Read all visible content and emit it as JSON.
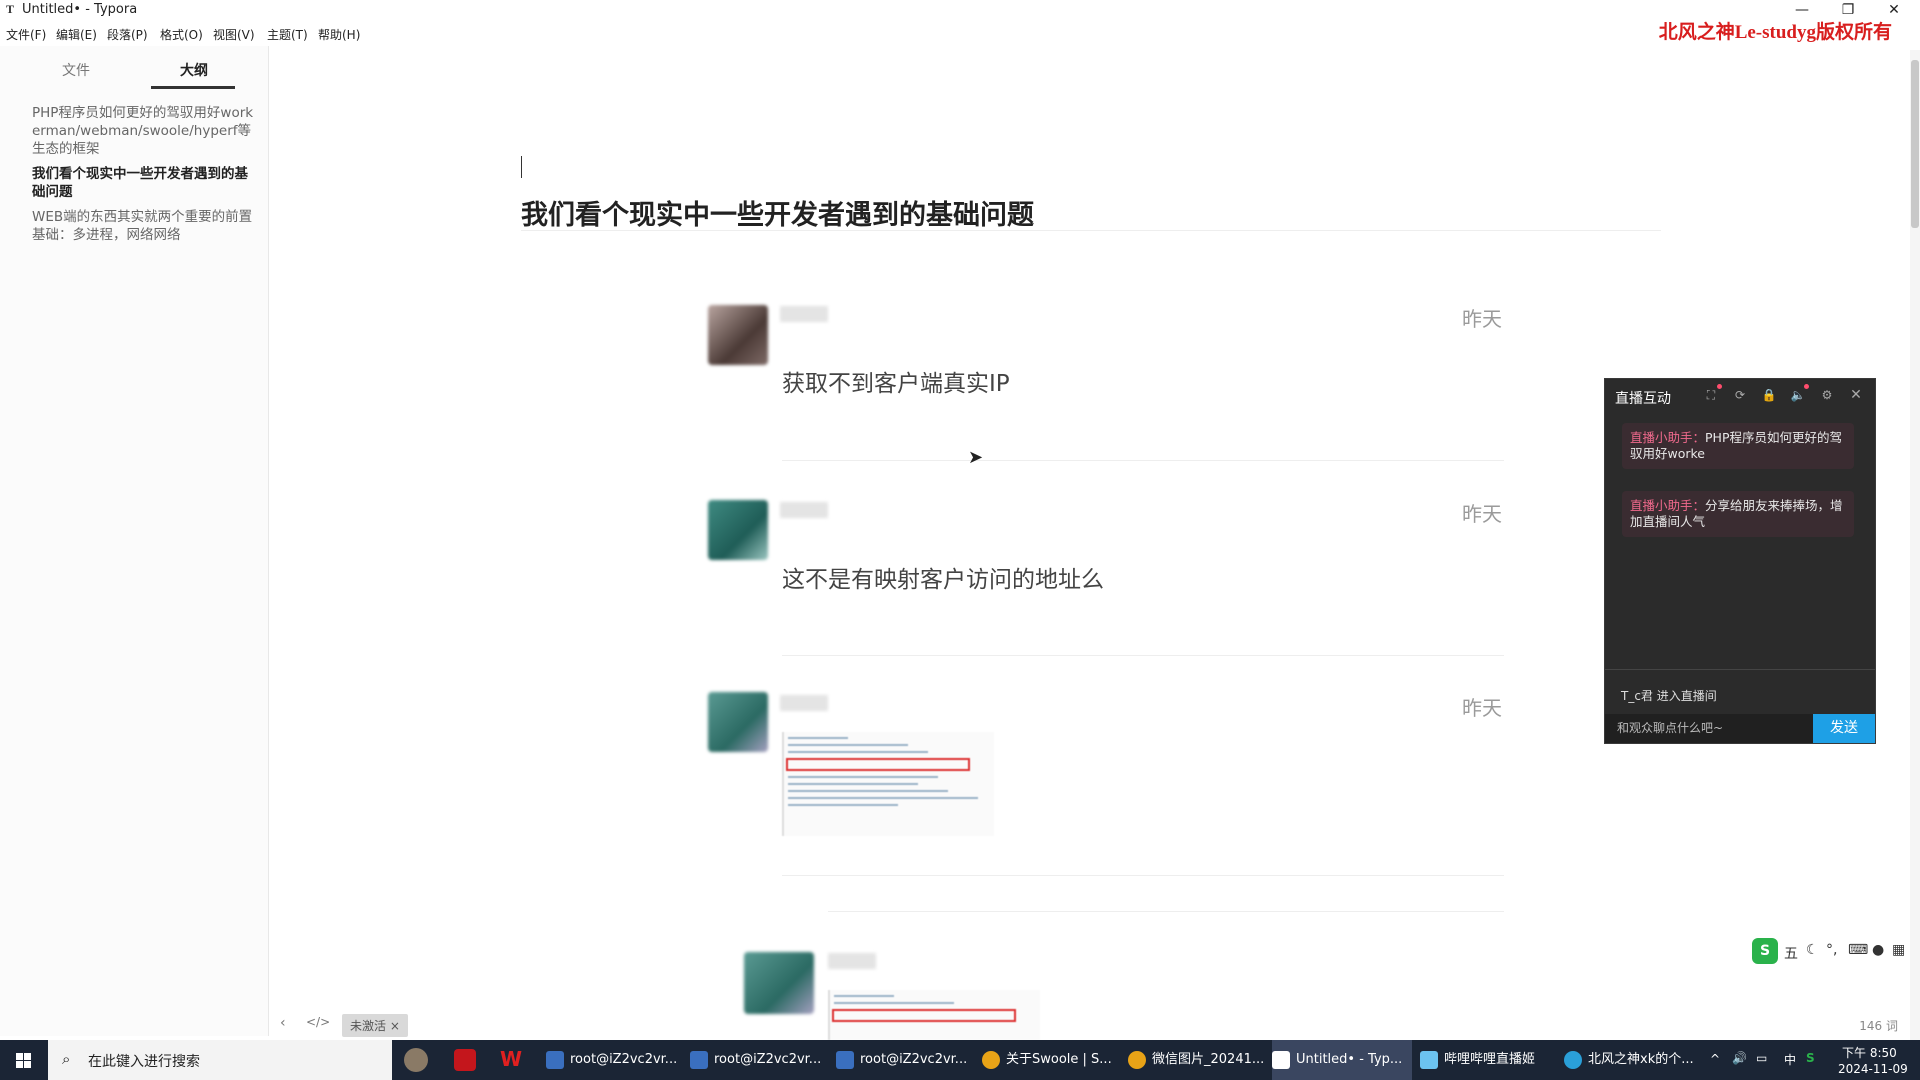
{
  "window": {
    "app_glyph": "T",
    "title": "Untitled• - Typora",
    "controls": {
      "minimize": "—",
      "restore": "❐",
      "close": "✕"
    }
  },
  "menu": [
    "文件(F)",
    "编辑(E)",
    "段落(P)",
    "格式(O)",
    "视图(V)",
    "主题(T)",
    "帮助(H)"
  ],
  "watermark": "北风之神Le-studyg版权所有",
  "sidebar": {
    "tabs": [
      "文件",
      "大纲"
    ],
    "outline": [
      "PHP程序员如何更好的驾驭用好workerman/webman/swoole/hyperf等生态的框架",
      "我们看个现实中一些开发者遇到的基础问题",
      "WEB端的东西其实就两个重要的前置基础：多进程，网络网络"
    ]
  },
  "editor": {
    "heading": "我们看个现实中一些开发者遇到的基础问题",
    "posts": [
      {
        "time": "昨天",
        "text": "获取不到客户端真实IP"
      },
      {
        "time": "昨天",
        "text": "这不是有映射客户访问的地址么"
      },
      {
        "time": "昨天",
        "text": ""
      }
    ]
  },
  "live": {
    "title": "直播互动",
    "messages": [
      {
        "who": "直播小助手：",
        "text": "PHP程序员如何更好的驾驭用好worke"
      },
      {
        "who": "直播小助手：",
        "text": "分享给朋友来捧捧场，增加直播间人气"
      }
    ],
    "enter_notice": "T_c君 进入直播间",
    "input_placeholder": "和观众聊点什么吧~",
    "send": "发送"
  },
  "ime": {
    "mode": "五"
  },
  "statusbar": {
    "badge": "未激活 ×",
    "word_count": "146 词"
  },
  "taskbar": {
    "search_placeholder": "在此键入进行搜索",
    "tasks": [
      "root@iZ2vc2vr...",
      "root@iZ2vc2vr...",
      "root@iZ2vc2vr...",
      "关于Swoole | S...",
      "微信图片_20241...",
      "Untitled• - Typ...",
      "哔哩哔哩直播姬",
      "北风之神xk的个..."
    ],
    "clock_time": "下午 8:50",
    "clock_date": "2024-11-09",
    "ime_indicator": "中"
  },
  "colors": {
    "accent_send": "#1ea0e6",
    "watermark": "#d81e1e",
    "taskbar": "#1b2535"
  }
}
